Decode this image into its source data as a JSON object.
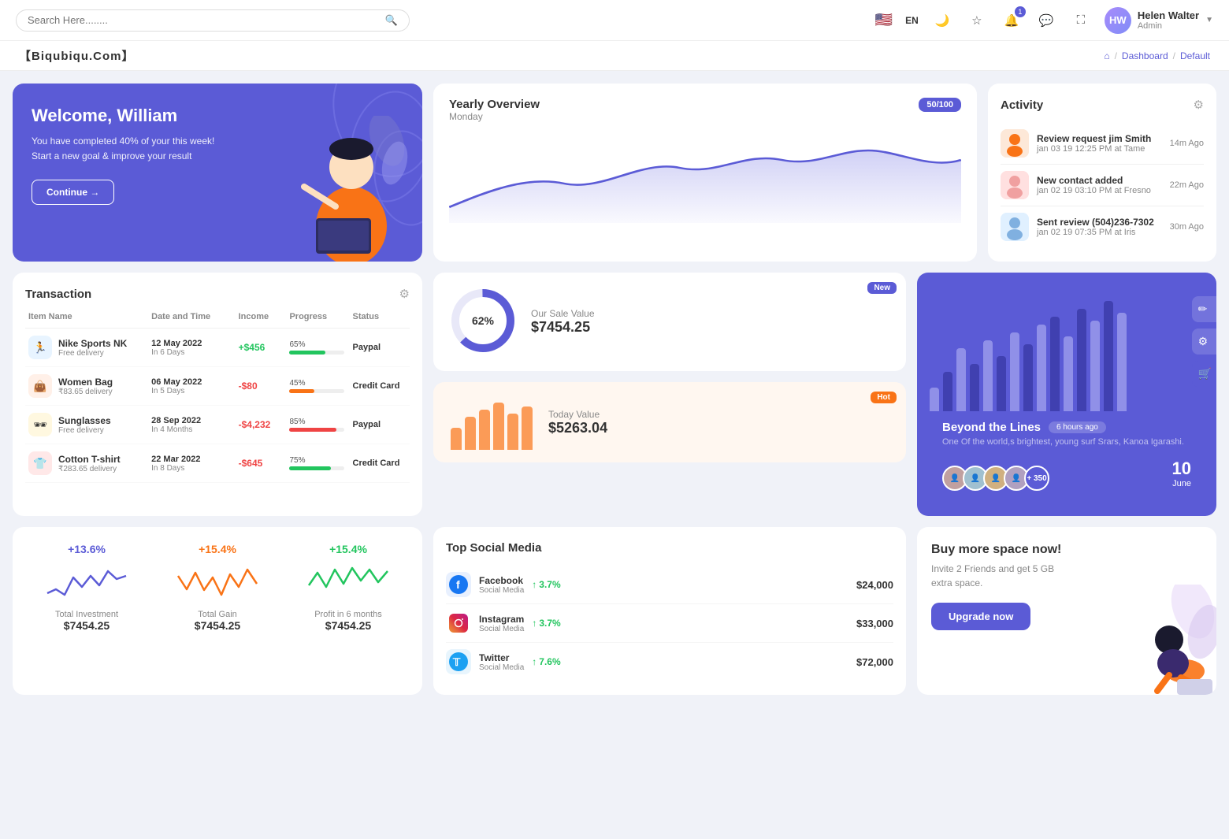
{
  "topnav": {
    "search_placeholder": "Search Here........",
    "lang": "EN",
    "user_name": "Helen Walter",
    "user_role": "Admin",
    "bell_badge": "1"
  },
  "breadcrumb": {
    "brand": "【Biqubiqu.Com】",
    "home": "⌂",
    "path1": "Dashboard",
    "path2": "Default"
  },
  "welcome": {
    "title": "Welcome, William",
    "body": "You have completed 40% of your this week! Start a new goal & improve your result",
    "button": "Continue →"
  },
  "yearly": {
    "title": "Yearly Overview",
    "badge": "50/100",
    "sub": "Monday"
  },
  "activity": {
    "title": "Activity",
    "items": [
      {
        "name": "Review request jim Smith",
        "detail": "jan 03 19 12:25 PM at Tame",
        "time": "14m Ago"
      },
      {
        "name": "New contact added",
        "detail": "jan 02 19 03:10 PM at Fresno",
        "time": "22m Ago"
      },
      {
        "name": "Sent review (504)236-7302",
        "detail": "jan 02 19 07:35 PM at Iris",
        "time": "30m Ago"
      }
    ]
  },
  "transaction": {
    "title": "Transaction",
    "headers": [
      "Item Name",
      "Date and Time",
      "Income",
      "Progress",
      "Status"
    ],
    "rows": [
      {
        "icon": "🏃",
        "name": "Nike Sports NK",
        "sub": "Free delivery",
        "date": "12 May 2022",
        "date_sub": "In 6 Days",
        "income": "+$456",
        "positive": true,
        "progress": 65,
        "progress_color": "#22c55e",
        "status": "Paypal"
      },
      {
        "icon": "👜",
        "name": "Women Bag",
        "sub": "₹83.65 delivery",
        "date": "06 May 2022",
        "date_sub": "In 5 Days",
        "income": "-$80",
        "positive": false,
        "progress": 45,
        "progress_color": "#f97316",
        "status": "Credit Card"
      },
      {
        "icon": "🕶",
        "name": "Sunglasses",
        "sub": "Free delivery",
        "date": "28 Sep 2022",
        "date_sub": "In 4 Months",
        "income": "-$4,232",
        "positive": false,
        "progress": 85,
        "progress_color": "#ef4444",
        "status": "Paypal"
      },
      {
        "icon": "👕",
        "name": "Cotton T-shirt",
        "sub": "₹283.65 delivery",
        "date": "22 Mar 2022",
        "date_sub": "In 8 Days",
        "income": "-$645",
        "positive": false,
        "progress": 75,
        "progress_color": "#22c55e",
        "status": "Credit Card"
      }
    ]
  },
  "sale_value": {
    "donut_pct": "62%",
    "label": "Our Sale Value",
    "amount": "$7454.25",
    "badge": "New"
  },
  "today_value": {
    "label": "Today Value",
    "amount": "$5263.04",
    "badge": "Hot"
  },
  "beyond": {
    "title": "Beyond the Lines",
    "time": "6 hours ago",
    "body": "One Of the world,s brightest, young surf Srars, Kanoa Igarashi.",
    "plus_count": "+ 350",
    "date": "10",
    "month": "June"
  },
  "stats": [
    {
      "pct": "+13.6%",
      "label": "Total Investment",
      "value": "$7454.25",
      "color": "#5b5bd6"
    },
    {
      "pct": "+15.4%",
      "label": "Total Gain",
      "value": "$7454.25",
      "color": "#f97316"
    },
    {
      "pct": "+15.4%",
      "label": "Profit in 6 months",
      "value": "$7454.25",
      "color": "#22c55e"
    }
  ],
  "social": {
    "title": "Top Social Media",
    "items": [
      {
        "name": "Facebook",
        "type": "Social Media",
        "pct": "3.7%",
        "amount": "$24,000",
        "icon": "f",
        "color": "#1877f2"
      },
      {
        "name": "Instagram",
        "type": "Social Media",
        "pct": "3.7%",
        "amount": "$33,000",
        "icon": "ig",
        "color": "#e1306c"
      },
      {
        "name": "Twitter",
        "type": "Social Media",
        "pct": "7.6%",
        "amount": "$72,000",
        "icon": "t",
        "color": "#1da1f2"
      }
    ]
  },
  "space": {
    "title": "Buy more space now!",
    "body": "Invite 2 Friends and get 5 GB extra space.",
    "button": "Upgrade now"
  },
  "bar_data": [
    30,
    50,
    80,
    60,
    90,
    70,
    100,
    85,
    110,
    120,
    95,
    130,
    115,
    140,
    125
  ],
  "sparkline1": [
    10,
    15,
    8,
    20,
    12,
    18,
    10,
    22,
    14,
    18
  ],
  "sparkline2": [
    18,
    10,
    22,
    14,
    20,
    8,
    16,
    12,
    22,
    10
  ],
  "sparkline3": [
    8,
    16,
    12,
    22,
    10,
    20,
    14,
    18,
    10,
    22
  ],
  "donut_today_bars": [
    30,
    45,
    55,
    65,
    50,
    60
  ]
}
